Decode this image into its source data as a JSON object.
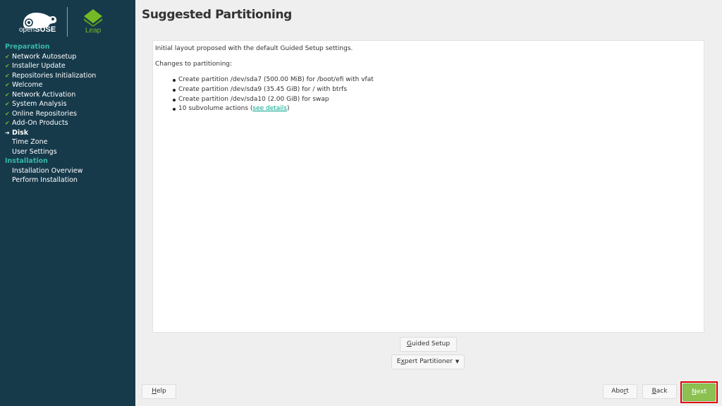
{
  "branding": {
    "opensuse_prefix": "open",
    "opensuse_name": "SUSE",
    "leap_label": "Leap",
    "brand_green": "#73ba25",
    "sidebar_bg": "#173a4b",
    "group_color": "#35b9ab"
  },
  "sidebar": {
    "groups": [
      {
        "label": "Preparation",
        "steps": [
          {
            "label": "Network Autosetup",
            "status": "done"
          },
          {
            "label": "Installer Update",
            "status": "done"
          },
          {
            "label": "Repositories Initialization",
            "status": "done"
          },
          {
            "label": "Welcome",
            "status": "done"
          },
          {
            "label": "Network Activation",
            "status": "done"
          },
          {
            "label": "System Analysis",
            "status": "done"
          },
          {
            "label": "Online Repositories",
            "status": "done"
          },
          {
            "label": "Add-On Products",
            "status": "done"
          },
          {
            "label": "Disk",
            "status": "current"
          },
          {
            "label": "Time Zone",
            "status": "pending"
          },
          {
            "label": "User Settings",
            "status": "pending"
          }
        ]
      },
      {
        "label": "Installation",
        "steps": [
          {
            "label": "Installation Overview",
            "status": "pending"
          },
          {
            "label": "Perform Installation",
            "status": "pending"
          }
        ]
      }
    ],
    "icons": {
      "done": "✔",
      "current": "➔",
      "pending": ""
    }
  },
  "main": {
    "title": "Suggested Partitioning",
    "intro": "Initial layout proposed with the default Guided Setup settings.",
    "changes_label": "Changes to partitioning:",
    "changes": [
      "Create partition /dev/sda7 (500.00 MiB) for /boot/efi with vfat",
      "Create partition /dev/sda9 (35.45 GiB) for / with btrfs",
      "Create partition /dev/sda10 (2.00 GiB) for swap"
    ],
    "subvolume_prefix": "10 subvolume actions (",
    "subvolume_link": "see details",
    "subvolume_suffix": ")"
  },
  "buttons": {
    "guided_setup": {
      "accel": "G",
      "rest": "uided Setup"
    },
    "expert_partitioner": {
      "pre": "E",
      "accel": "x",
      "rest": "pert Partitioner",
      "arrow": "▼"
    },
    "help": {
      "accel": "H",
      "rest": "elp"
    },
    "abort": {
      "pre": "Abo",
      "accel": "r",
      "rest": "t"
    },
    "back": {
      "accel": "B",
      "rest": "ack"
    },
    "next": {
      "accel": "N",
      "rest": "ext"
    }
  }
}
